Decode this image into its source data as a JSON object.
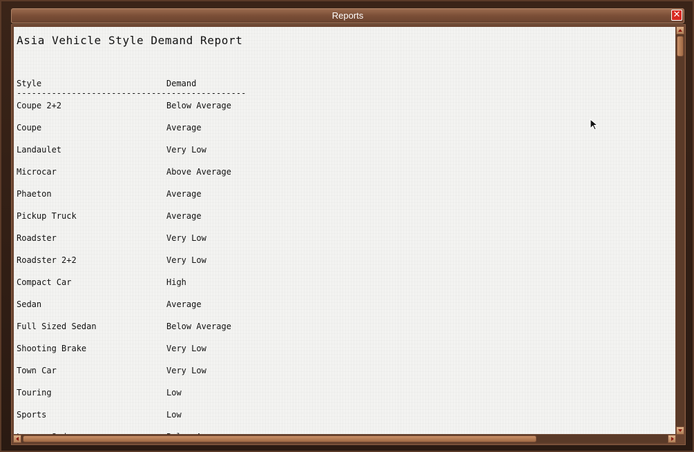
{
  "window": {
    "title": "Reports",
    "close_glyph": "✕"
  },
  "report": {
    "title": "Asia Vehicle Style Demand Report",
    "columns": {
      "style": "Style",
      "demand": "Demand"
    },
    "separator": "----------------------------------------------",
    "rows": [
      {
        "style": "Coupe 2+2",
        "demand": "Below Average"
      },
      {
        "style": "Coupe",
        "demand": "Average"
      },
      {
        "style": "Landaulet",
        "demand": "Very Low"
      },
      {
        "style": "Microcar",
        "demand": "Above Average"
      },
      {
        "style": "Phaeton",
        "demand": "Average"
      },
      {
        "style": "Pickup Truck",
        "demand": "Average"
      },
      {
        "style": "Roadster",
        "demand": "Very Low"
      },
      {
        "style": "Roadster 2+2",
        "demand": "Very Low"
      },
      {
        "style": "Compact Car",
        "demand": "High"
      },
      {
        "style": "Sedan",
        "demand": "Average"
      },
      {
        "style": "Full Sized Sedan",
        "demand": "Below Average"
      },
      {
        "style": "Shooting Brake",
        "demand": "Very Low"
      },
      {
        "style": "Town Car",
        "demand": "Very Low"
      },
      {
        "style": "Touring",
        "demand": "Low"
      },
      {
        "style": "Sports",
        "demand": "Low"
      },
      {
        "style": "Luxury Sedan",
        "demand": "Below Average"
      }
    ]
  },
  "icons": {
    "close": "close-icon",
    "scroll_up": "arrow-up-icon",
    "scroll_down": "arrow-down-icon",
    "scroll_left": "arrow-left-icon",
    "scroll_right": "arrow-right-icon",
    "cursor": "mouse-pointer-icon"
  },
  "colors": {
    "frame": "#6a4430",
    "titlebar": "#8a5a40",
    "close_button": "#d82a22",
    "paper": "#f3f3f1"
  }
}
